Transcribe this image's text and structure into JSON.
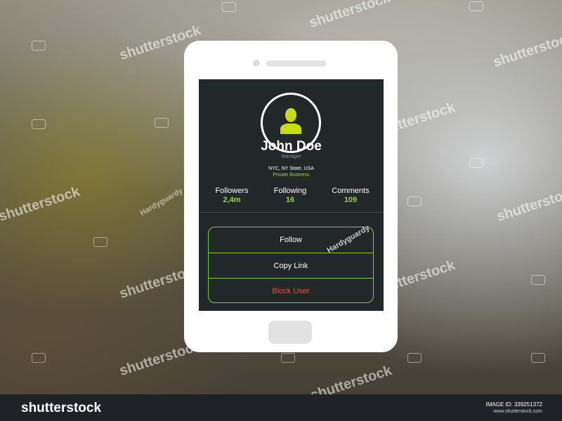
{
  "profile": {
    "name": "John Doe",
    "role": "Manager",
    "location": "NYC, NY State, USA",
    "business": "Private Business"
  },
  "stats": [
    {
      "label": "Followers",
      "value": "2,4m"
    },
    {
      "label": "Following",
      "value": "16"
    },
    {
      "label": "Comments",
      "value": "109"
    }
  ],
  "actions": {
    "follow": "Follow",
    "copy_link": "Copy Link",
    "block_user": "Block User"
  },
  "watermark": {
    "brand": "shutterstock",
    "contributor": "Hardyguardy"
  },
  "footer": {
    "brand": "shutterstock",
    "image_id": "IMAGE ID: 339251372",
    "site": "www.shutterstock.com"
  },
  "colors": {
    "accent_green": "#9bd046",
    "avatar_yellow": "#c7dc16",
    "danger": "#e8573a",
    "screen_bg": "#22272a"
  },
  "icons": {
    "avatar": "user-silhouette-icon"
  }
}
